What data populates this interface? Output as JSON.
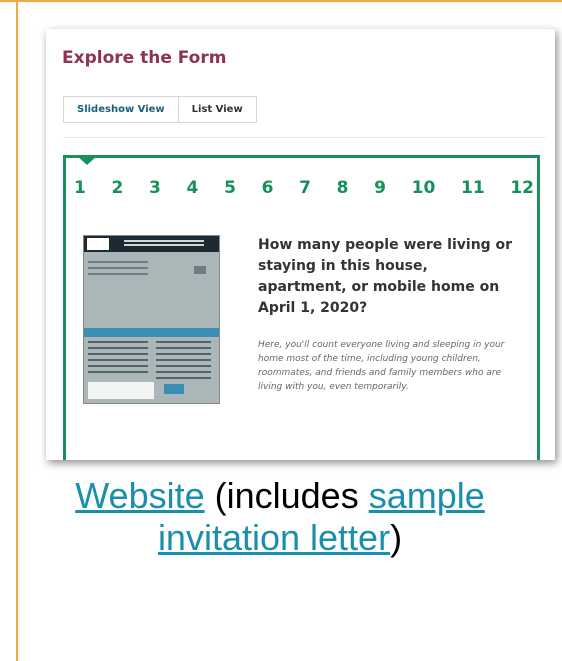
{
  "card": {
    "title": "Explore the Form",
    "tabs": [
      {
        "label": "Slideshow View"
      },
      {
        "label": "List View"
      }
    ],
    "steps": [
      "1",
      "2",
      "3",
      "4",
      "5",
      "6",
      "7",
      "8",
      "9",
      "10",
      "11",
      "12"
    ],
    "question": "How many people were living or staying in this house, apartment, or mobile home on April 1, 2020?",
    "description": "Here, you'll count everyone living and sleeping in your home most of the time, including young children, roommates, and friends and family members who are living with you, even temporarily."
  },
  "caption": {
    "link1": "Website",
    "text1": " (includes ",
    "link2": "sample invitation letter",
    "text2": ")"
  },
  "colors": {
    "accent_green": "#18905b",
    "title": "#8e3350",
    "link": "#1a8fad",
    "frame": "#f4a640"
  }
}
